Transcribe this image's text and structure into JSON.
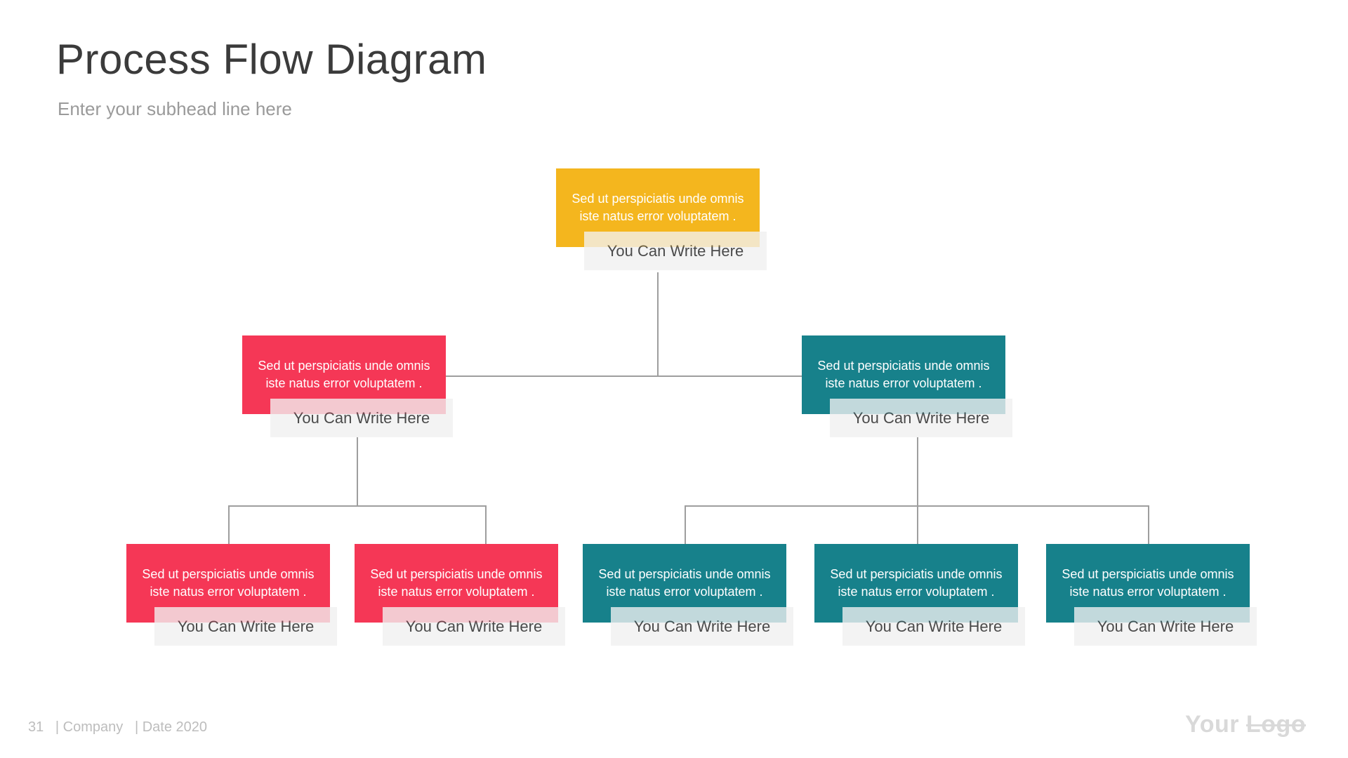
{
  "title": "Process Flow Diagram",
  "subhead": "Enter your subhead line here",
  "placeholder_text": "Sed ut perspiciatis unde omnis iste natus error voluptatem .",
  "write_here": "You Can Write Here",
  "nodes": {
    "root": {
      "text": "Sed ut perspiciatis unde omnis iste natus error voluptatem .",
      "label": "You Can Write Here"
    },
    "left": {
      "text": "Sed ut perspiciatis unde omnis iste natus error voluptatem .",
      "label": "You Can Write Here"
    },
    "right": {
      "text": "Sed ut perspiciatis unde omnis iste natus error voluptatem .",
      "label": "You Can Write Here"
    },
    "l1": {
      "text": "Sed ut perspiciatis unde omnis iste natus error voluptatem .",
      "label": "You Can Write Here"
    },
    "l2": {
      "text": "Sed ut perspiciatis unde omnis iste natus error voluptatem .",
      "label": "You Can Write Here"
    },
    "r1": {
      "text": "Sed ut perspiciatis unde omnis iste natus error voluptatem .",
      "label": "You Can Write Here"
    },
    "r2": {
      "text": "Sed ut perspiciatis unde omnis iste natus error voluptatem .",
      "label": "You Can Write Here"
    },
    "r3": {
      "text": "Sed ut perspiciatis unde omnis iste natus error voluptatem .",
      "label": "You Can Write Here"
    }
  },
  "colors": {
    "yellow": "#f4b61e",
    "pink": "#f53756",
    "teal": "#17818b",
    "grey_box": "#f3f3f3",
    "connector": "#9e9e9e"
  },
  "footer": {
    "page": "31",
    "company": "| Company",
    "date": "| Date 2020"
  },
  "logo": {
    "part1": "Your ",
    "part2": "Logo"
  }
}
